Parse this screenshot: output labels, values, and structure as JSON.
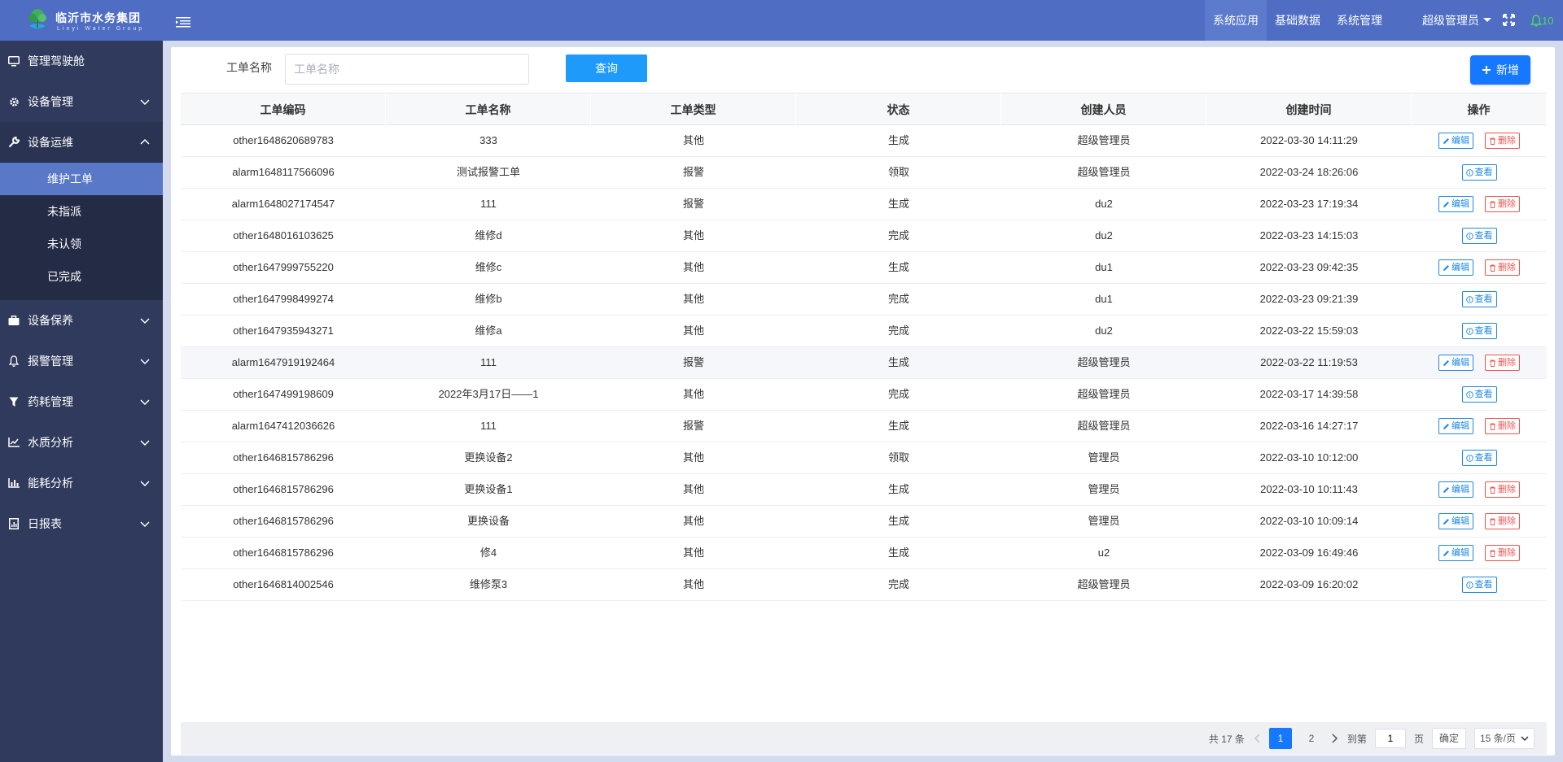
{
  "brand": {
    "title": "临沂市水务集团",
    "subtitle": "Linyi Water Group"
  },
  "topnav": [
    {
      "label": "系统应用",
      "active": true
    },
    {
      "label": "基础数据",
      "active": false
    },
    {
      "label": "系统管理",
      "active": false
    }
  ],
  "user": {
    "name": "超级管理员"
  },
  "notifications": {
    "count": "10"
  },
  "sidebar": {
    "items": [
      {
        "label": "管理驾驶舱",
        "icon": "monitor-icon"
      },
      {
        "label": "设备管理",
        "icon": "gear-icon"
      },
      {
        "label": "设备运维",
        "icon": "wrench-icon"
      },
      {
        "label": "设备保养",
        "icon": "briefcase-icon"
      },
      {
        "label": "报警管理",
        "icon": "bell-icon"
      },
      {
        "label": "药耗管理",
        "icon": "filter-icon"
      },
      {
        "label": "水质分析",
        "icon": "line-chart-icon"
      },
      {
        "label": "能耗分析",
        "icon": "bar-chart-icon"
      },
      {
        "label": "日报表",
        "icon": "report-icon"
      }
    ],
    "submenu": [
      {
        "label": "维护工单",
        "active": true
      },
      {
        "label": "未指派",
        "active": false
      },
      {
        "label": "未认领",
        "active": false
      },
      {
        "label": "已完成",
        "active": false
      }
    ]
  },
  "search": {
    "label": "工单名称",
    "placeholder": "工单名称",
    "value": "",
    "button": "查询"
  },
  "add_button": "新增",
  "table": {
    "columns": [
      "工单编码",
      "工单名称",
      "工单类型",
      "状态",
      "创建人员",
      "创建时间",
      "操作"
    ],
    "rows": [
      {
        "code": "other1648620689783",
        "name": "333",
        "type": "其他",
        "status": "生成",
        "creator": "超级管理员",
        "time": "2022-03-30 14:11:29",
        "ops": "edit"
      },
      {
        "code": "alarm1648117566096",
        "name": "测试报警工单",
        "type": "报警",
        "status": "领取",
        "creator": "超级管理员",
        "time": "2022-03-24 18:26:06",
        "ops": "view"
      },
      {
        "code": "alarm1648027174547",
        "name": "111",
        "type": "报警",
        "status": "生成",
        "creator": "du2",
        "time": "2022-03-23 17:19:34",
        "ops": "edit"
      },
      {
        "code": "other1648016103625",
        "name": "维修d",
        "type": "其他",
        "status": "完成",
        "creator": "du2",
        "time": "2022-03-23 14:15:03",
        "ops": "view"
      },
      {
        "code": "other1647999755220",
        "name": "维修c",
        "type": "其他",
        "status": "生成",
        "creator": "du1",
        "time": "2022-03-23 09:42:35",
        "ops": "edit"
      },
      {
        "code": "other1647998499274",
        "name": "维修b",
        "type": "其他",
        "status": "完成",
        "creator": "du1",
        "time": "2022-03-23 09:21:39",
        "ops": "view"
      },
      {
        "code": "other1647935943271",
        "name": "维修a",
        "type": "其他",
        "status": "完成",
        "creator": "du2",
        "time": "2022-03-22 15:59:03",
        "ops": "view"
      },
      {
        "code": "alarm1647919192464",
        "name": "111",
        "type": "报警",
        "status": "生成",
        "creator": "超级管理员",
        "time": "2022-03-22 11:19:53",
        "ops": "edit",
        "highlight": true
      },
      {
        "code": "other1647499198609",
        "name": "2022年3月17日——1",
        "type": "其他",
        "status": "完成",
        "creator": "超级管理员",
        "time": "2022-03-17 14:39:58",
        "ops": "view"
      },
      {
        "code": "alarm1647412036626",
        "name": "111",
        "type": "报警",
        "status": "生成",
        "creator": "超级管理员",
        "time": "2022-03-16 14:27:17",
        "ops": "edit"
      },
      {
        "code": "other1646815786296",
        "name": "更换设备2",
        "type": "其他",
        "status": "领取",
        "creator": "管理员",
        "time": "2022-03-10 10:12:00",
        "ops": "view"
      },
      {
        "code": "other1646815786296",
        "name": "更换设备1",
        "type": "其他",
        "status": "生成",
        "creator": "管理员",
        "time": "2022-03-10 10:11:43",
        "ops": "edit"
      },
      {
        "code": "other1646815786296",
        "name": "更换设备",
        "type": "其他",
        "status": "生成",
        "creator": "管理员",
        "time": "2022-03-10 10:09:14",
        "ops": "edit"
      },
      {
        "code": "other1646815786296",
        "name": "修4",
        "type": "其他",
        "status": "生成",
        "creator": "u2",
        "time": "2022-03-09 16:49:46",
        "ops": "edit"
      },
      {
        "code": "other1646814002546",
        "name": "维修泵3",
        "type": "其他",
        "status": "完成",
        "creator": "超级管理员",
        "time": "2022-03-09 16:20:02",
        "ops": "view"
      }
    ],
    "op_labels": {
      "edit": "编辑",
      "delete": "删除",
      "view": "查看"
    }
  },
  "pagination": {
    "total": "共 17 条",
    "pages": [
      "1",
      "2"
    ],
    "current": "1",
    "goto_label": "到第",
    "goto_value": "1",
    "page_suffix": "页",
    "confirm": "确定",
    "page_size": "15 条/页"
  },
  "colors": {
    "header": "#4e6dc3",
    "sidebar": "#2f3a5c",
    "accent": "#1677ff",
    "danger": "#ef5350",
    "bell": "#4cd964"
  }
}
